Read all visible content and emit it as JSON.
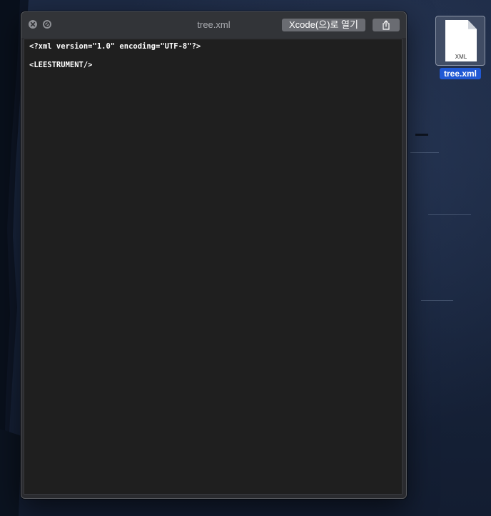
{
  "window": {
    "title": "tree.xml",
    "open_with_label": "Xcode(으)로 열기",
    "close_icon": "close-icon",
    "fullscreen_icon": "fullscreen-icon",
    "share_icon": "share-icon"
  },
  "document": {
    "lines": [
      "<?xml version=\"1.0\" encoding=\"UTF-8\"?>",
      "",
      "<LEESTRUMENT/>"
    ]
  },
  "desktop": {
    "file": {
      "name": "tree.xml",
      "type_label": "XML",
      "icon": "xml-file-icon"
    }
  },
  "colors": {
    "accent": "#2159d4",
    "window_bg": "#2a2b2f",
    "content_bg": "#1f1f1f"
  }
}
